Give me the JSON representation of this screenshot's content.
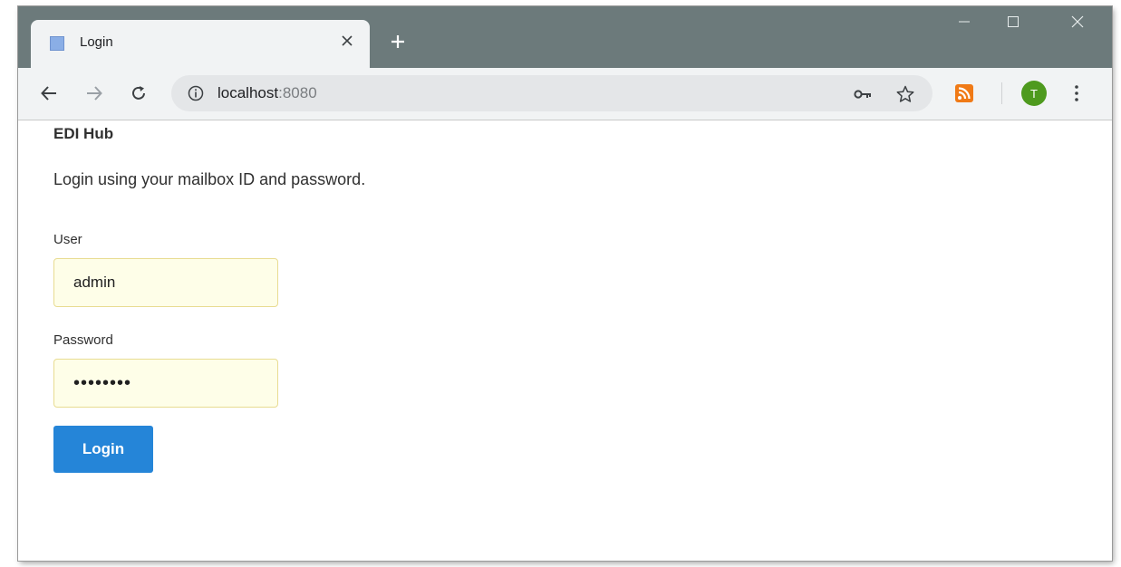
{
  "browser": {
    "tab": {
      "title": "Login",
      "close_glyph": "✕"
    },
    "new_tab_glyph": "+",
    "window_controls": {
      "minimize": "—",
      "maximize": "☐",
      "close": "✕"
    },
    "address": {
      "host": "localhost",
      "port": ":8080"
    },
    "profile_initial": "T",
    "icons": [
      "back-arrow-icon",
      "forward-arrow-icon",
      "reload-icon",
      "info-icon",
      "key-icon",
      "star-icon",
      "rss-icon",
      "menu-dots-icon"
    ]
  },
  "page": {
    "app_title": "EDI Hub",
    "intro": "Login using your mailbox ID and password.",
    "user_label": "User",
    "user_value": "admin",
    "password_label": "Password",
    "password_value": "••••••••",
    "login_button": "Login"
  },
  "colors": {
    "titlebar": "#6c7a7b",
    "toolbar": "#f1f3f4",
    "accent_button": "#2585d8",
    "autofill_field": "#fefee8",
    "avatar": "#4e9a1e",
    "rss": "#f07a16"
  }
}
